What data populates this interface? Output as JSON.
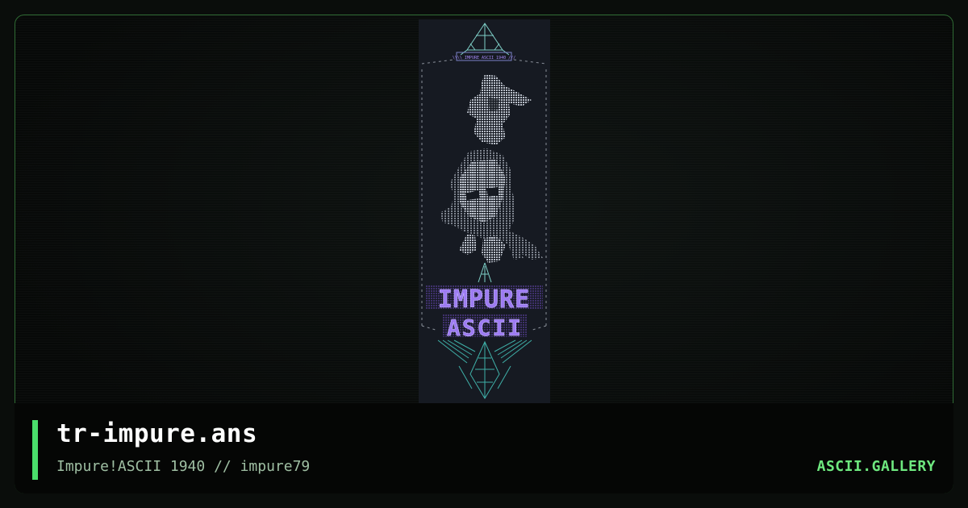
{
  "card": {
    "title": "tr-impure.ans",
    "subtitle": "Impure!ASCII 1940 // impure79",
    "brand": "ASCII.GALLERY"
  },
  "artwork": {
    "header_tag": "\\\\\\\\ IMPURE ASCII 1940 ///",
    "logo_line1": "IMPURE",
    "logo_line2": "ASCII"
  },
  "colors": {
    "page_background": "#0a0d0b",
    "frame_border": "#2f6b34",
    "accent": "#4ade6b",
    "brand": "#6ee87f",
    "subtitle": "#9fbfa3",
    "art_background": "#161a22",
    "logo_purple": "#8b5cf6",
    "ascii_gray": "#9aa0aa",
    "ascii_teal": "#3fb0a8"
  },
  "icons": {
    "art_top_emblem": "triangle-crown-icon",
    "art_bottom_emblem": "diamond-wings-icon"
  }
}
